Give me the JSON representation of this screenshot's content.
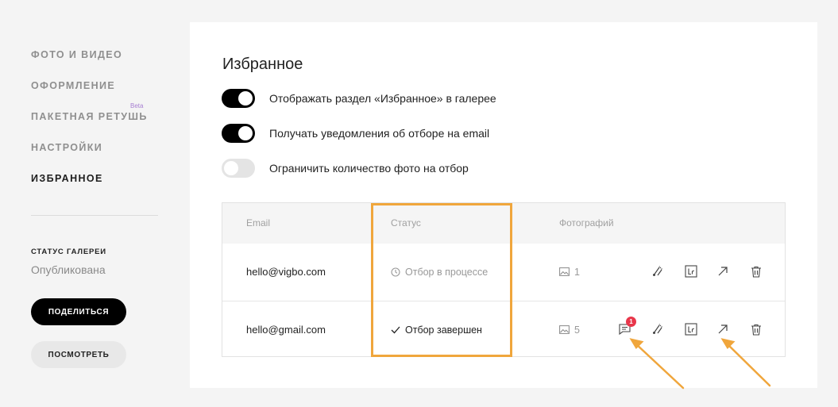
{
  "sidebar": {
    "nav": [
      {
        "label": "ФОТО И ВИДЕО",
        "active": false
      },
      {
        "label": "ОФОРМЛЕНИЕ",
        "active": false
      },
      {
        "label": "ПАКЕТНАЯ РЕТУШЬ",
        "active": false,
        "badge": "Beta"
      },
      {
        "label": "НАСТРОЙКИ",
        "active": false
      },
      {
        "label": "ИЗБРАННОЕ",
        "active": true
      }
    ],
    "gallery_status_title": "СТАТУС ГАЛЕРЕИ",
    "gallery_status_value": "Опубликована",
    "share_button": "ПОДЕЛИТЬСЯ",
    "view_button": "ПОСМОТРЕТЬ"
  },
  "main": {
    "title": "Избранное",
    "toggles": [
      {
        "label": "Отображать раздел «Избранное» в галерее",
        "on": true
      },
      {
        "label": "Получать уведомления об отборе на email",
        "on": true
      },
      {
        "label": "Ограничить количество фото на отбор",
        "on": false
      }
    ],
    "table": {
      "headers": {
        "email": "Email",
        "status": "Статус",
        "photos": "Фотографий"
      },
      "rows": [
        {
          "email": "hello@vigbo.com",
          "status": "Отбор в процессе",
          "status_icon": "clock-icon",
          "photos": "1",
          "comments_badge": null
        },
        {
          "email": "hello@gmail.com",
          "status": "Отбор завершен",
          "status_icon": "check-icon",
          "photos": "5",
          "comments_badge": "1"
        }
      ],
      "actions": [
        "retouch-icon",
        "lightroom-icon",
        "open-link-icon",
        "trash-icon"
      ]
    }
  },
  "colors": {
    "accent_annotation": "#f0a63c",
    "badge": "#e8364a",
    "beta": "#a77fd2"
  }
}
